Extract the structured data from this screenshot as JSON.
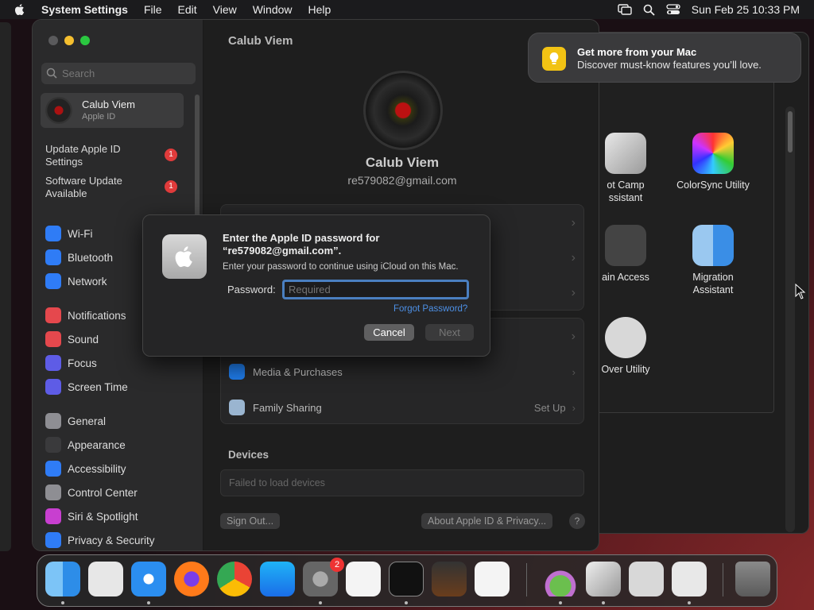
{
  "menubar": {
    "app_name": "System Settings",
    "menus": [
      "File",
      "Edit",
      "View",
      "Window",
      "Help"
    ],
    "datetime": "Sun Feb 25  10:33 PM"
  },
  "settings": {
    "search_placeholder": "Search",
    "account": {
      "name": "Calub Viem",
      "sub": "Apple ID"
    },
    "updates": [
      {
        "label": "Update Apple ID Settings",
        "badge": "1"
      },
      {
        "label": "Software Update Available",
        "badge": "1"
      }
    ],
    "sidebar_items": [
      {
        "label": "Wi-Fi",
        "icon": "wifi-icon",
        "color": "#2f7cf6"
      },
      {
        "label": "Bluetooth",
        "icon": "bluetooth-icon",
        "color": "#2f7cf6"
      },
      {
        "label": "Network",
        "icon": "globe-icon",
        "color": "#2f7cf6"
      },
      {
        "label": "Notifications",
        "icon": "bell-icon",
        "color": "#e5484d"
      },
      {
        "label": "Sound",
        "icon": "speaker-icon",
        "color": "#e5484d"
      },
      {
        "label": "Focus",
        "icon": "moon-icon",
        "color": "#5e5ce6"
      },
      {
        "label": "Screen Time",
        "icon": "hourglass-icon",
        "color": "#5e5ce6"
      },
      {
        "label": "General",
        "icon": "gear-icon",
        "color": "#8e8e93"
      },
      {
        "label": "Appearance",
        "icon": "appearance-icon",
        "color": "#3a3a3c"
      },
      {
        "label": "Accessibility",
        "icon": "accessibility-icon",
        "color": "#2f7cf6"
      },
      {
        "label": "Control Center",
        "icon": "control-center-icon",
        "color": "#8e8e93"
      },
      {
        "label": "Siri & Spotlight",
        "icon": "siri-icon",
        "color": "#c83fd0"
      },
      {
        "label": "Privacy & Security",
        "icon": "hand-icon",
        "color": "#2f7cf6"
      }
    ],
    "content_title": "Calub Viem",
    "profile_name": "Calub Viem",
    "profile_email": "re579082@gmail.com",
    "rows": [
      {
        "label": "Media & Purchases",
        "right": ""
      },
      {
        "label": "Family Sharing",
        "right": "Set Up"
      }
    ],
    "devices_label": "Devices",
    "devices_status": "Failed to load devices",
    "sign_out": "Sign Out...",
    "about": "About Apple ID & Privacy...",
    "help": "?"
  },
  "dialog": {
    "title": "Enter the Apple ID password for “re579082@gmail.com”.",
    "subtitle": "Enter your password to continue using iCloud on this Mac.",
    "password_label": "Password:",
    "password_placeholder": "Required",
    "forgot": "Forgot Password?",
    "cancel": "Cancel",
    "next": "Next"
  },
  "notification": {
    "title": "Get more from your Mac",
    "body": "Discover must-know features you’ll love."
  },
  "utilities": [
    {
      "label": "Boot Camp\nAssistant",
      "shown": "ot Camp\nssistant"
    },
    {
      "label": "ColorSync Utility",
      "shown": "ColorSync Utility"
    },
    {
      "label": "Keychain Access",
      "shown": "ain Access"
    },
    {
      "label": "Migration Assistant",
      "shown": "Migration\nAssistant"
    },
    {
      "label": "VoiceOver Utility",
      "shown": "Over Utility"
    }
  ],
  "dock": {
    "settings_badge": "2",
    "apps": [
      "finder-icon",
      "launchpad-icon",
      "safari-icon",
      "firefox-icon",
      "chrome-icon",
      "app-store-icon",
      "system-settings-icon",
      "textedit-icon",
      "terminal-icon",
      "garageband-icon",
      "vscode-icon",
      "installer-icon",
      "bootcamp-icon",
      "calculator-icon",
      "disk-utility-icon",
      "trash-icon"
    ]
  }
}
